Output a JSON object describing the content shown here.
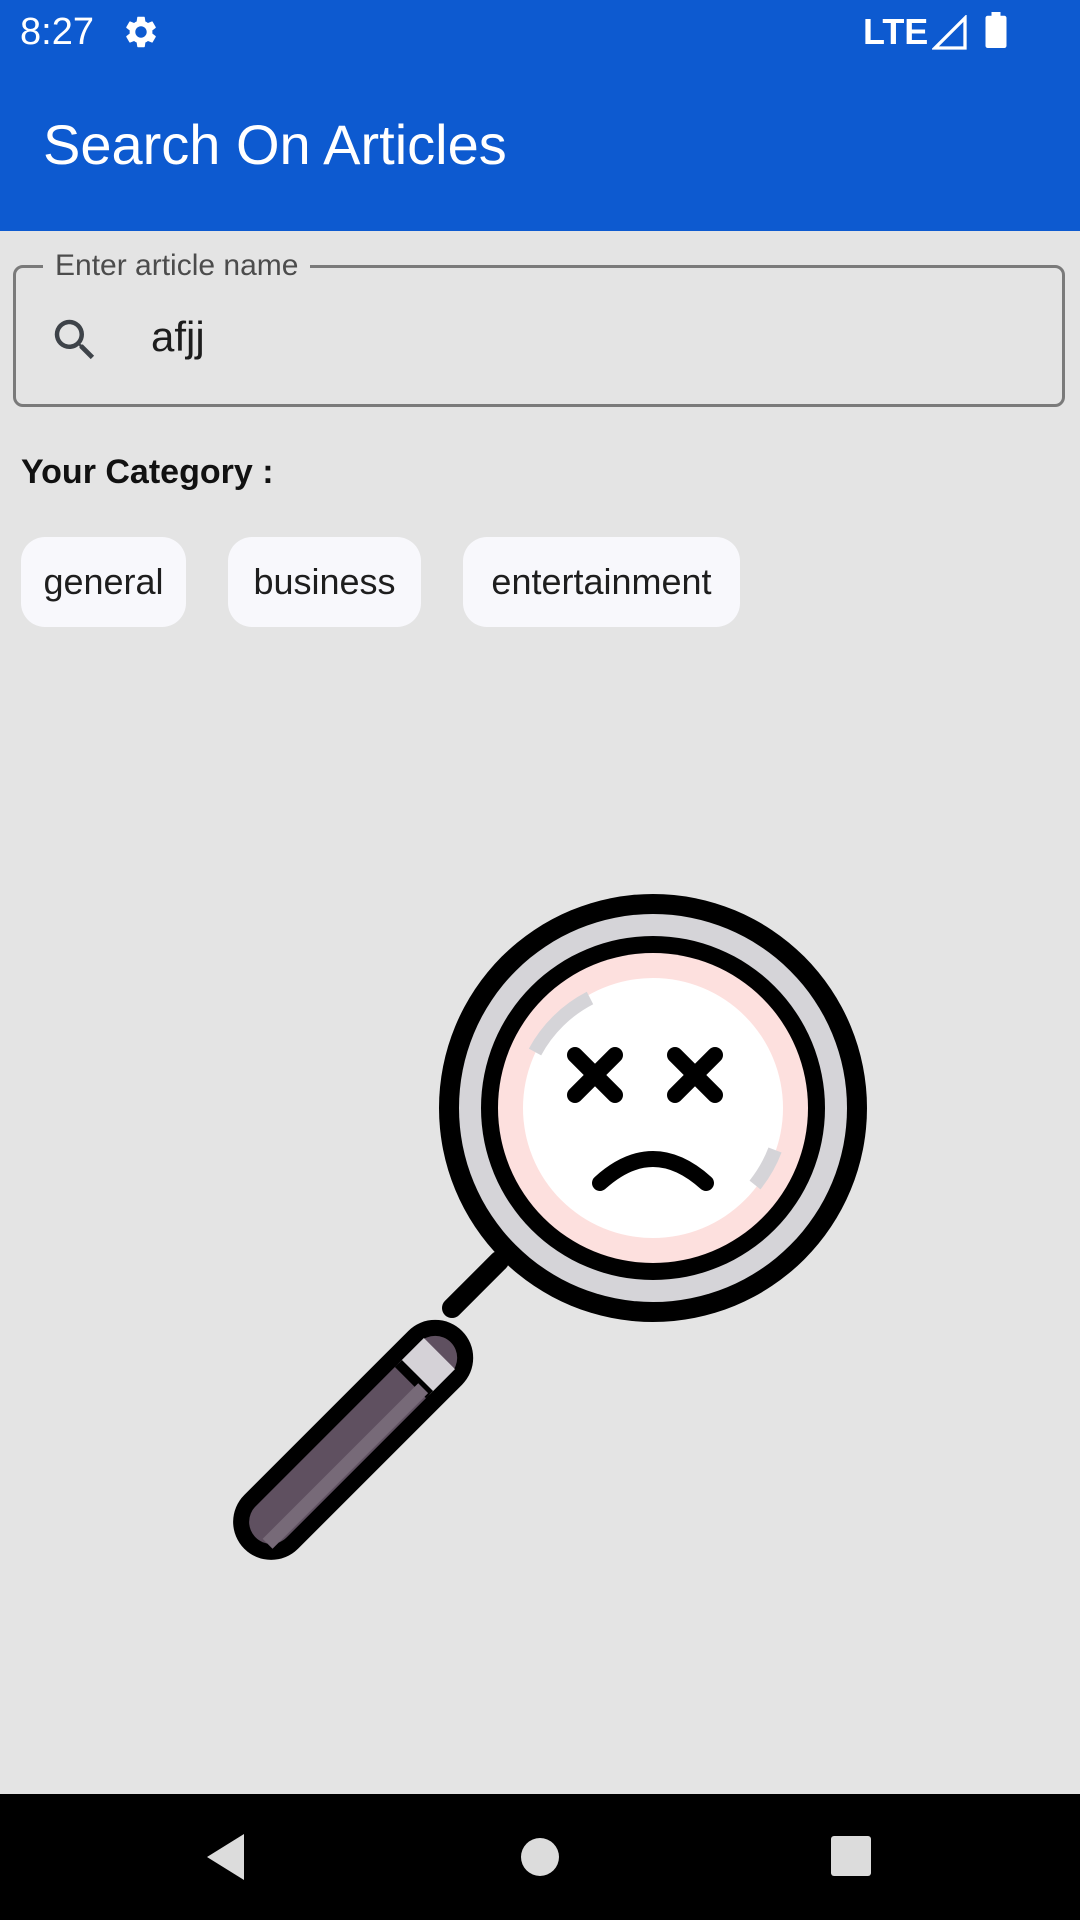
{
  "status_bar": {
    "time": "8:27",
    "network": "LTE",
    "icons": [
      "gear-icon",
      "signal-icon",
      "battery-icon"
    ]
  },
  "app_bar": {
    "title": "Search On Articles",
    "color": "#0d5ad0"
  },
  "search": {
    "label": "Enter article name",
    "value": "afjj",
    "icon": "search-icon"
  },
  "categories": {
    "heading": "Your Category :",
    "chips": [
      "general",
      "business",
      "entertainment"
    ]
  },
  "empty_state": {
    "icon": "no-results-magnifier-icon"
  },
  "nav_bar": {
    "icons": [
      "back-icon",
      "home-icon",
      "recents-icon"
    ]
  },
  "colors": {
    "background": "#e4e4e4",
    "chip_background": "#f8f8fc",
    "nav_bar": "#000000"
  }
}
